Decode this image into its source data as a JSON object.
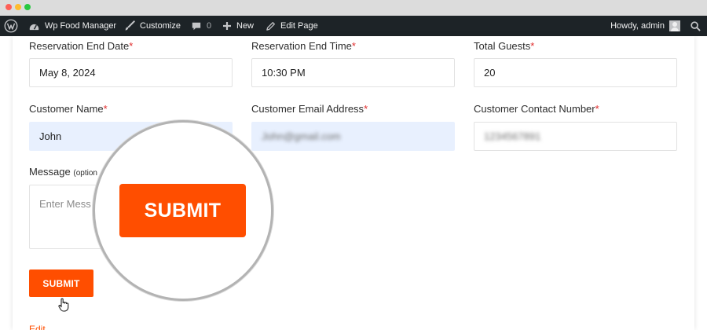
{
  "admin_bar": {
    "site_name": "Wp Food Manager",
    "customize": "Customize",
    "comments_count": "0",
    "new": "New",
    "edit_page": "Edit Page",
    "howdy": "Howdy, admin"
  },
  "form": {
    "end_date": {
      "label": "Reservation End Date",
      "required": "*",
      "value": "May 8, 2024"
    },
    "end_time": {
      "label": "Reservation End Time",
      "required": "*",
      "value": "10:30 PM"
    },
    "guests": {
      "label": "Total Guests",
      "required": "*",
      "value": "20"
    },
    "name": {
      "label": "Customer Name",
      "required": "*",
      "value": "John"
    },
    "email": {
      "label": "Customer Email Address",
      "required": "*",
      "value": "John@gmail.com"
    },
    "phone": {
      "label": "Customer Contact Number",
      "required": "*",
      "value": "1234567891"
    },
    "message": {
      "label": "Message",
      "optional": "(option",
      "placeholder": "Enter Mess"
    },
    "submit_label": "SUBMIT",
    "edit_link": "Edit"
  },
  "zoom": {
    "button_label": "SUBMIT"
  },
  "colors": {
    "accent": "#ff4e00",
    "admin_bar": "#1d2327",
    "required": "#e02b2b",
    "autofill": "#e8f0fe"
  },
  "icons": [
    "wordpress-icon",
    "dashboard-icon",
    "brush-icon",
    "comment-icon",
    "plus-icon",
    "pencil-icon",
    "avatar",
    "search-icon",
    "hand-pointer-icon"
  ]
}
